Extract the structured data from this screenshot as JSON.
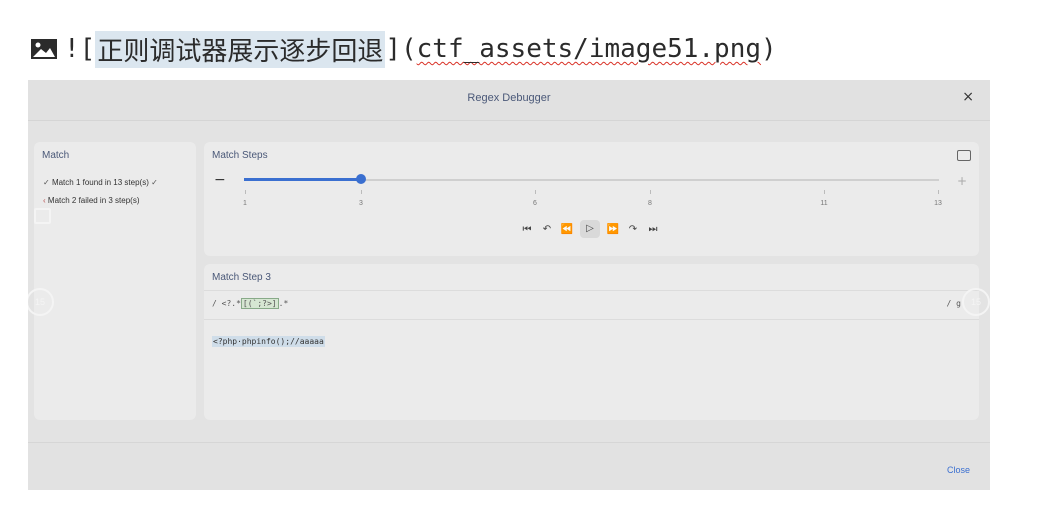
{
  "markdown": {
    "prefix": "![",
    "alt": "正则调试器展示逐步回退",
    "mid": "](",
    "path": "ctf_assets/image51.png",
    "suffix": ")"
  },
  "window": {
    "title": "Regex Debugger",
    "close_glyph": "×"
  },
  "match_panel": {
    "title": "Match",
    "items": [
      {
        "label": "Match 1 found in 13 step(s)",
        "status": "found"
      },
      {
        "label": "Match 2 failed in 3 step(s)",
        "status": "failed"
      }
    ]
  },
  "steps_panel": {
    "title": "Match Steps",
    "minus": "−",
    "plus": "+",
    "slider": {
      "min": 1,
      "max": 13,
      "value": 3
    },
    "ticks": [
      "1",
      "3",
      "6",
      "8",
      "11",
      "13"
    ],
    "controls": [
      "⏮",
      "↶",
      "⏪",
      "▷",
      "⏩",
      "↷",
      "⏭"
    ]
  },
  "step_panel": {
    "title": "Match Step 3",
    "regex_prefix": "/ <?.*",
    "regex_highlight": "[(`;?>]",
    "regex_suffix": ".*",
    "regex_flags": "/ g",
    "test_string": "<?php·phpinfo();//aaaaa"
  },
  "footer": {
    "close_label": "Close"
  },
  "overlay": {
    "left_badge": "15",
    "right_badge": "15"
  }
}
